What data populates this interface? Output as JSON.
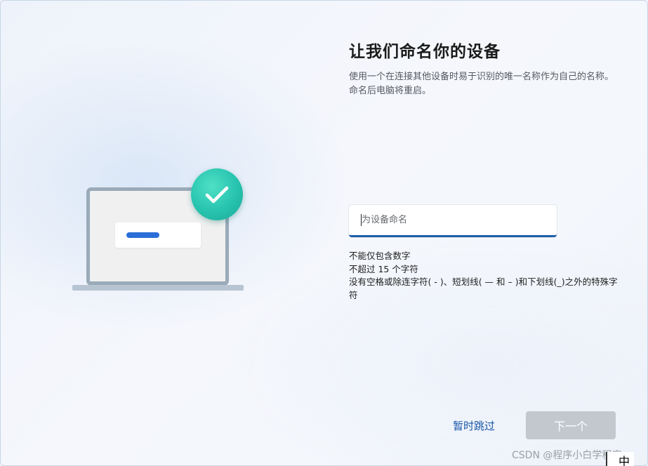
{
  "page": {
    "title": "让我们命名你的设备",
    "description": "使用一个在连接其他设备时易于识别的唯一名称作为自己的名称。命名后电脑将重启。"
  },
  "device_name_input": {
    "placeholder": "为设备命名",
    "value": ""
  },
  "rules": [
    "不能仅包含数字",
    "不超过 15 个字符",
    "没有空格或除连字符( - )、短划线( — 和 – )和下划线(_)之外的特殊字符"
  ],
  "buttons": {
    "skip_label": "暂时跳过",
    "next_label": "下一个"
  },
  "watermark": "CSDN @程序小白学程序",
  "ime_indicator": "中",
  "colors": {
    "accent": "#1e5fa9",
    "link": "#1a56a8",
    "check_badge": "#27c3ae",
    "disabled_button": "#c3c8cf"
  },
  "icons": {
    "illustration": "laptop-with-checkmark"
  }
}
